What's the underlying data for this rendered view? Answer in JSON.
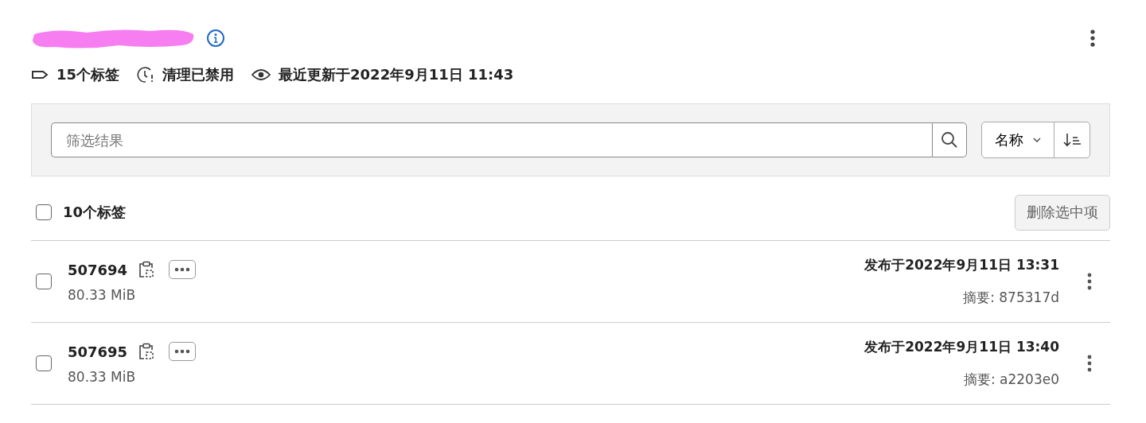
{
  "header": {
    "title_redacted": true,
    "meta": [
      {
        "kind": "tag",
        "text": "15个标签"
      },
      {
        "kind": "cleanup",
        "text": "清理已禁用"
      },
      {
        "kind": "updated",
        "text": "最近更新于2022年9月11日 11:43"
      }
    ]
  },
  "filter": {
    "search": {
      "placeholder": "筛选结果"
    },
    "sort": {
      "label": "名称"
    }
  },
  "list_header": {
    "select_all": {
      "checked": false
    },
    "count": "10个标签",
    "delete_button": {
      "label": "删除选中项",
      "disabled": true
    }
  },
  "rows": [
    {
      "name": "507694",
      "size": "80.33 MiB",
      "published": "发布于2022年9月11日 13:31",
      "digest": "摘要: 875317d",
      "checked": false
    },
    {
      "name": "507695",
      "size": "80.33 MiB",
      "published": "发布于2022年9月11日 13:40",
      "digest": "摘要: a2203e0",
      "checked": false
    }
  ]
}
